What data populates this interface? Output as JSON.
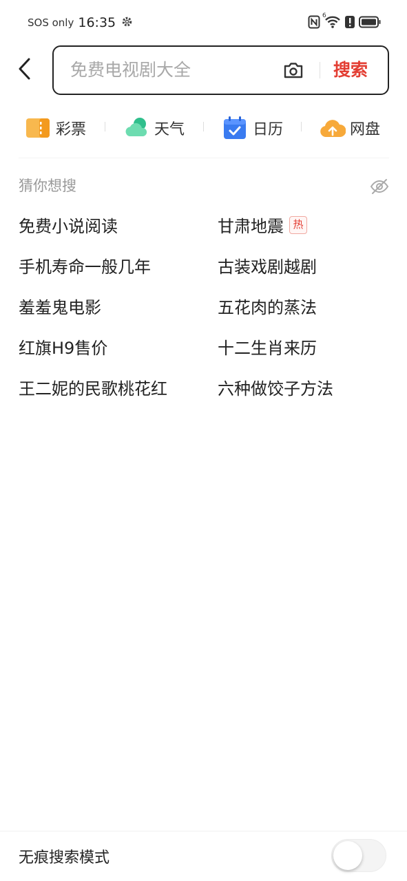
{
  "status_bar": {
    "carrier_text": "SOS only",
    "time": "16:35",
    "network_sup": "6"
  },
  "search": {
    "placeholder": "免费电视剧大全",
    "button_label": "搜索"
  },
  "shortcuts": [
    {
      "label": "彩票",
      "icon": "lottery-icon",
      "color": "#f5a623"
    },
    {
      "label": "天气",
      "icon": "weather-icon",
      "color": "#3ccf9e"
    },
    {
      "label": "日历",
      "icon": "calendar-icon",
      "color": "#3a7bf0"
    },
    {
      "label": "网盘",
      "icon": "cloud-drive-icon",
      "color": "#f5a623"
    }
  ],
  "suggestions": {
    "title": "猜你想搜",
    "hot_badge": "热",
    "left": [
      "免费小说阅读",
      "手机寿命一般几年",
      "羞羞鬼电影",
      "红旗H9售价",
      "王二妮的民歌桃花红"
    ],
    "right": [
      "甘肃地震",
      "古装戏剧越剧",
      "五花肉的蒸法",
      "十二生肖来历",
      "六种做饺子方法"
    ]
  },
  "footer": {
    "incognito_label": "无痕搜索模式",
    "incognito_enabled": false
  },
  "colors": {
    "accent": "#e33e33",
    "text": "#222222",
    "muted": "#999999"
  }
}
